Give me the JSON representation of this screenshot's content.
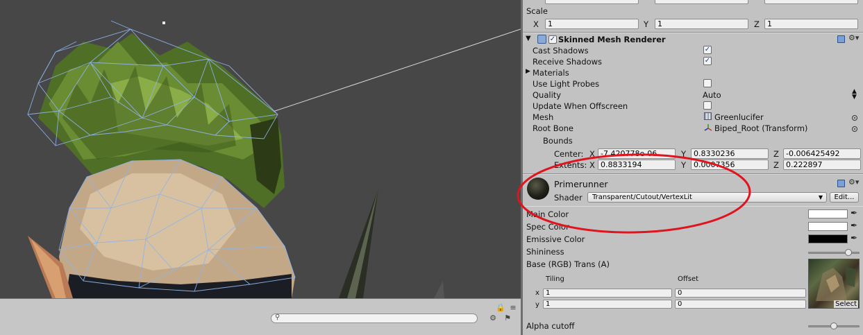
{
  "transform": {
    "scale_label": "Scale",
    "scale": {
      "x_label": "X",
      "x": "1",
      "y_label": "Y",
      "y": "1",
      "z_label": "Z",
      "z": "1"
    }
  },
  "renderer": {
    "title": "Skinned Mesh Renderer",
    "cast_shadows_label": "Cast Shadows",
    "cast_shadows_checked": true,
    "receive_shadows_label": "Receive Shadows",
    "receive_shadows_checked": true,
    "materials_label": "Materials",
    "light_probes_label": "Use Light Probes",
    "light_probes_checked": false,
    "quality_label": "Quality",
    "quality_value": "Auto",
    "offscreen_label": "Update When Offscreen",
    "offscreen_checked": false,
    "mesh_label": "Mesh",
    "mesh_value": "Greenlucifer",
    "root_bone_label": "Root Bone",
    "root_bone_value": "Biped_Root (Transform)",
    "bounds_label": "Bounds",
    "center_label": "Center:",
    "center": {
      "x_label": "X",
      "x": "-7.420778e-06",
      "y_label": "Y",
      "y": "0.8330236",
      "z_label": "Z",
      "z": "-0.006425492"
    },
    "extents_label": "Extents:",
    "extents": {
      "x_label": "X",
      "x": "0.8833194",
      "y_label": "Y",
      "y": "0.0007356",
      "z_label": "Z",
      "z": "0.222897"
    }
  },
  "material": {
    "name": "Primerunner",
    "shader_label": "Shader",
    "shader_value": "Transparent/Cutout/VertexLit",
    "edit_button": "Edit...",
    "main_color_label": "Main Color",
    "spec_color_label": "Spec Color",
    "emissive_color_label": "Emissive Color",
    "shininess_label": "Shininess",
    "base_label": "Base (RGB) Trans (A)",
    "tiling_label": "Tiling",
    "offset_label": "Offset",
    "x_label": "x",
    "y_label": "y",
    "tiling_x": "1",
    "tiling_y": "1",
    "offset_x": "0",
    "offset_y": "0",
    "select_button": "Select",
    "alpha_cutoff_label": "Alpha cutoff"
  },
  "colors": {
    "main_color": "#ffffff",
    "spec_color": "#ffffff",
    "emissive_color": "#000000",
    "annotation": "#e0141e",
    "wireframe": "#8fb4ea"
  },
  "icons": [
    "component-toggle-icon",
    "help-book-icon",
    "gear-icon",
    "object-picker-icon",
    "eyedropper-icon",
    "search-icon",
    "lock-icon",
    "menu-icon"
  ]
}
